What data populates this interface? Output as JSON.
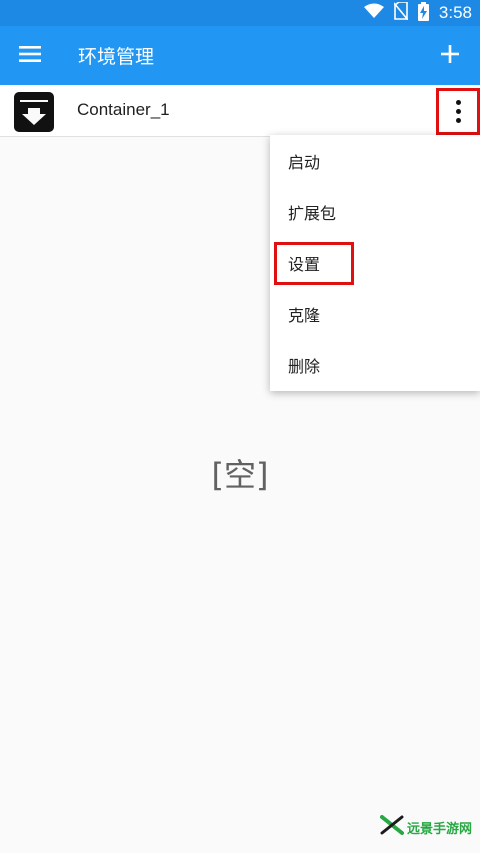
{
  "status_bar": {
    "time": "3:58",
    "icons": [
      "wifi-icon",
      "no-sim-icon",
      "battery-charging-icon"
    ]
  },
  "app_bar": {
    "title": "环境管理",
    "menu_icon": "hamburger-menu-icon",
    "add_icon": "plus-icon"
  },
  "container": {
    "name": "Container_1",
    "icon": "archive-download-icon",
    "more_icon": "more-vert-icon"
  },
  "popup_menu": {
    "items": [
      "启动",
      "扩展包",
      "设置",
      "克隆",
      "删除"
    ],
    "highlighted": "设置"
  },
  "empty_state": {
    "text": "[空]"
  },
  "watermark": {
    "text": "远景手游网"
  },
  "colors": {
    "app_bar": "#2196f3",
    "status_bar": "#1e88e5",
    "highlight": "#e01010",
    "background": "#fafafa",
    "watermark": "#27a844"
  }
}
